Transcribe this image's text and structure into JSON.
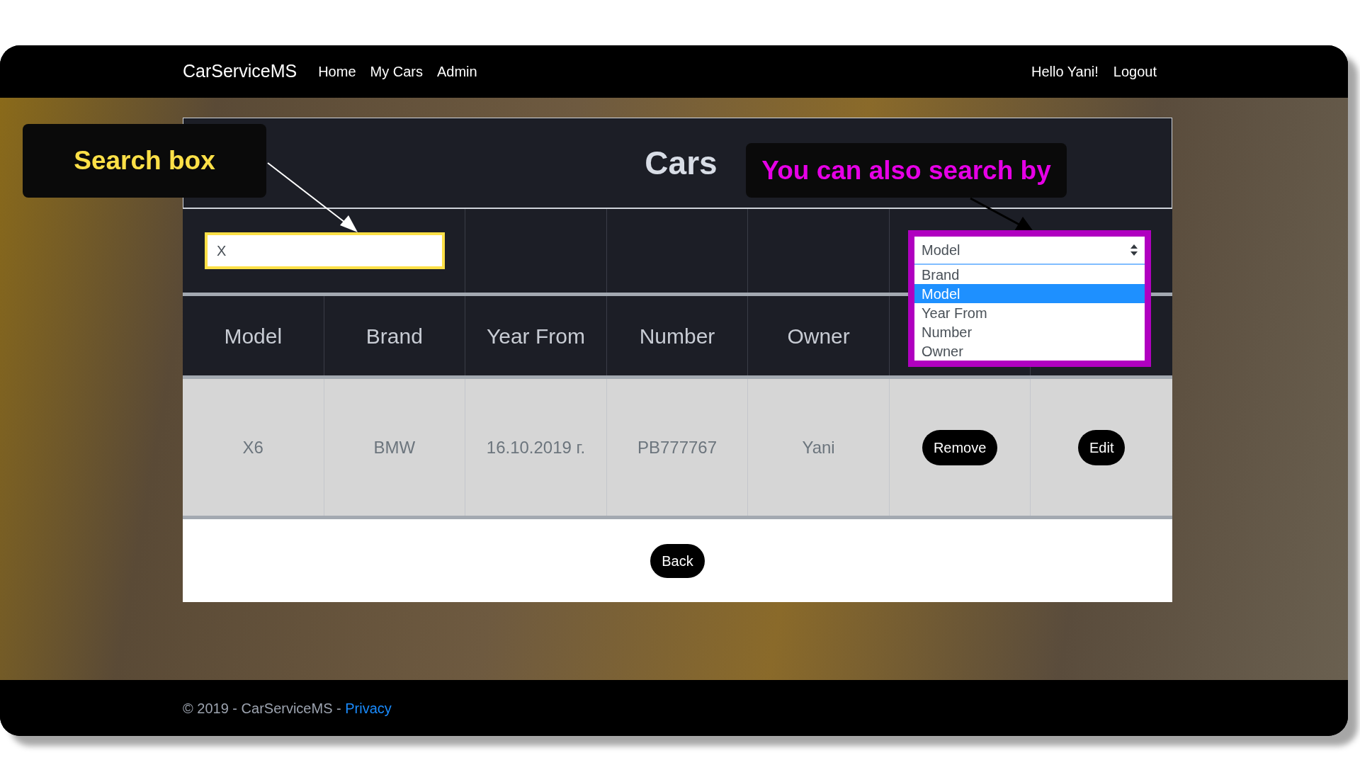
{
  "navbar": {
    "brand": "CarServiceMS",
    "links": [
      {
        "label": "Home"
      },
      {
        "label": "My Cars"
      },
      {
        "label": "Admin"
      }
    ],
    "greeting": "Hello Yani!",
    "logout": "Logout"
  },
  "annotations": [
    {
      "text": "Search box",
      "color": "#fde047"
    },
    {
      "text": "You can also search by",
      "color": "#e600e6"
    }
  ],
  "title": "Cars",
  "search": {
    "value": "X"
  },
  "search_by": {
    "value": "Model",
    "options": [
      {
        "label": "Brand",
        "selected": false
      },
      {
        "label": "Model",
        "selected": true
      },
      {
        "label": "Year From",
        "selected": false
      },
      {
        "label": "Number",
        "selected": false
      },
      {
        "label": "Owner",
        "selected": false
      }
    ]
  },
  "table": {
    "columns": [
      "Model",
      "Brand",
      "Year From",
      "Number",
      "Owner"
    ],
    "rows": [
      {
        "cells": [
          "X6",
          "BMW",
          "16.10.2019 г.",
          "PB777767",
          "Yani"
        ],
        "actions": [
          "Remove",
          "Edit"
        ]
      }
    ]
  },
  "back_button": "Back",
  "footer": {
    "text": "© 2019 - CarServiceMS - ",
    "link": "Privacy"
  }
}
